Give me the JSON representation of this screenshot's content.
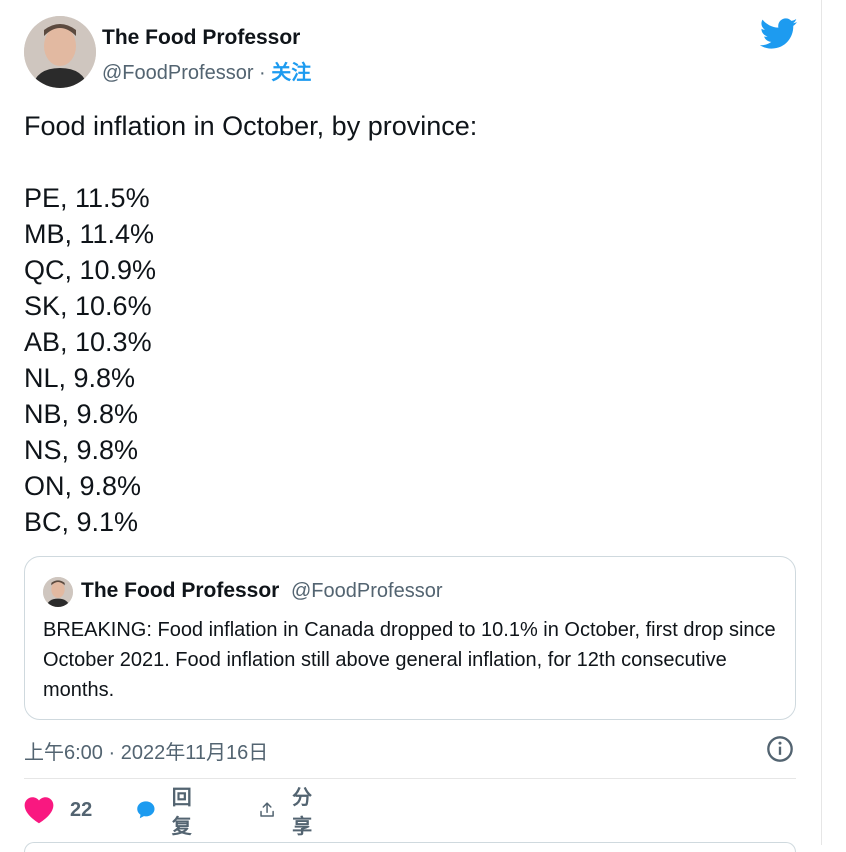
{
  "tweet": {
    "author_name": "The Food Professor",
    "handle": "@FoodProfessor",
    "separator": "·",
    "follow_label": "关注",
    "text_intro": "Food inflation in October, by province:",
    "province_lines": [
      "PE, 11.5%",
      "MB, 11.4%",
      "QC, 10.9%",
      "SK, 10.6%",
      "AB, 10.3%",
      "NL, 9.8%",
      "NB, 9.8%",
      "NS, 9.8%",
      "ON, 9.8%",
      "BC, 9.1%"
    ],
    "timestamp": "上午6:00 · 2022年11月16日"
  },
  "quoted_tweet": {
    "author_name": "The Food Professor",
    "handle": "@FoodProfessor",
    "text": "BREAKING: Food inflation in Canada dropped to 10.1% in October, first drop since October 2021. Food inflation still above general inflation, for 12th consecutive months."
  },
  "actions": {
    "like_count": "22",
    "reply_label": "回复",
    "share_label": "分享"
  },
  "icons": {
    "logo": "twitter-bird-icon",
    "info": "info-icon",
    "like": "heart-icon",
    "reply": "speech-bubble-icon",
    "share": "share-upload-icon"
  },
  "colors": {
    "brand_blue": "#1d9bf0",
    "like_red": "#f91880",
    "muted_text": "#536471",
    "text": "#0f1419"
  }
}
